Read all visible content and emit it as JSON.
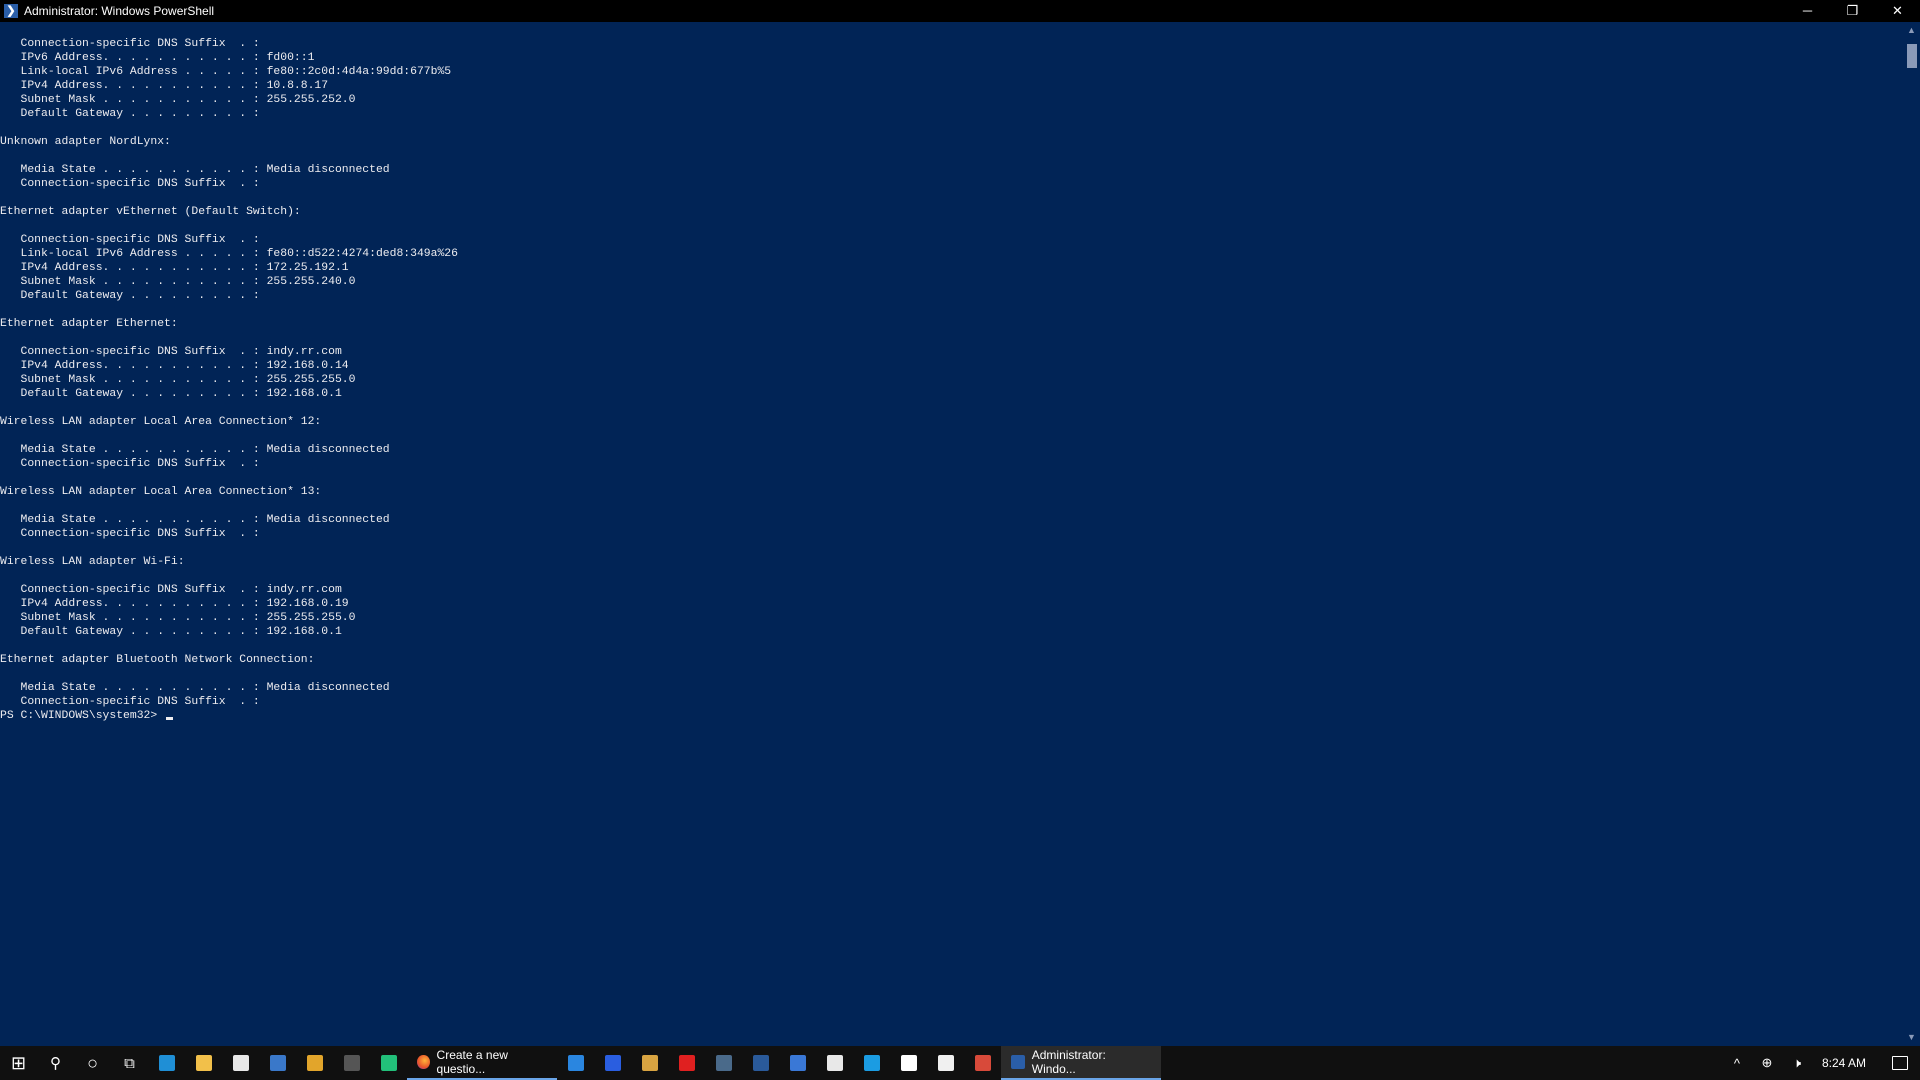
{
  "window": {
    "title": "Administrator: Windows PowerShell",
    "icon_glyph": "❯",
    "controls": {
      "minimize": "─",
      "restore": "❐",
      "close": "✕"
    }
  },
  "console": {
    "lines": [
      "   Connection-specific DNS Suffix  . :",
      "   IPv6 Address. . . . . . . . . . . : fd00::1",
      "   Link-local IPv6 Address . . . . . : fe80::2c0d:4d4a:99dd:677b%5",
      "   IPv4 Address. . . . . . . . . . . : 10.8.8.17",
      "   Subnet Mask . . . . . . . . . . . : 255.255.252.0",
      "   Default Gateway . . . . . . . . . :",
      "",
      "Unknown adapter NordLynx:",
      "",
      "   Media State . . . . . . . . . . . : Media disconnected",
      "   Connection-specific DNS Suffix  . :",
      "",
      "Ethernet adapter vEthernet (Default Switch):",
      "",
      "   Connection-specific DNS Suffix  . :",
      "   Link-local IPv6 Address . . . . . : fe80::d522:4274:ded8:349a%26",
      "   IPv4 Address. . . . . . . . . . . : 172.25.192.1",
      "   Subnet Mask . . . . . . . . . . . : 255.255.240.0",
      "   Default Gateway . . . . . . . . . :",
      "",
      "Ethernet adapter Ethernet:",
      "",
      "   Connection-specific DNS Suffix  . : indy.rr.com",
      "   IPv4 Address. . . . . . . . . . . : 192.168.0.14",
      "   Subnet Mask . . . . . . . . . . . : 255.255.255.0",
      "   Default Gateway . . . . . . . . . : 192.168.0.1",
      "",
      "Wireless LAN adapter Local Area Connection* 12:",
      "",
      "   Media State . . . . . . . . . . . : Media disconnected",
      "   Connection-specific DNS Suffix  . :",
      "",
      "Wireless LAN adapter Local Area Connection* 13:",
      "",
      "   Media State . . . . . . . . . . . : Media disconnected",
      "   Connection-specific DNS Suffix  . :",
      "",
      "Wireless LAN adapter Wi-Fi:",
      "",
      "   Connection-specific DNS Suffix  . : indy.rr.com",
      "   IPv4 Address. . . . . . . . . . . : 192.168.0.19",
      "   Subnet Mask . . . . . . . . . . . : 255.255.255.0",
      "   Default Gateway . . . . . . . . . : 192.168.0.1",
      "",
      "Ethernet adapter Bluetooth Network Connection:",
      "",
      "   Media State . . . . . . . . . . . : Media disconnected",
      "   Connection-specific DNS Suffix  . :"
    ],
    "prompt": "PS C:\\WINDOWS\\system32> ",
    "colors": {
      "background": "#012456",
      "foreground": "#eeedf0"
    }
  },
  "scrollbar": {
    "up_glyph": "▲",
    "down_glyph": "▼"
  },
  "taskbar": {
    "start_glyph": "⊞",
    "search_glyph": "⚲",
    "cortana_glyph": "○",
    "taskview_glyph": "⧉",
    "pinned": [
      {
        "name": "edge-icon",
        "color": "#1f8fd6"
      },
      {
        "name": "file-explorer-icon",
        "color": "#f2c04a"
      },
      {
        "name": "mail-icon",
        "color": "#e8e8e8"
      },
      {
        "name": "store-icon",
        "color": "#3a78c9"
      },
      {
        "name": "chrome-icon",
        "color": "#e2a52b"
      },
      {
        "name": "app-icon",
        "color": "#555555"
      },
      {
        "name": "green-app-icon",
        "color": "#22c07a"
      }
    ],
    "firefox_label": "Create a new questio...",
    "pinned2": [
      {
        "name": "blue-app-icon",
        "color": "#2a86e0"
      },
      {
        "name": "malwarebytes-icon",
        "color": "#2a5ee0"
      },
      {
        "name": "calculator-icon",
        "color": "#d9a441"
      },
      {
        "name": "opera-icon",
        "color": "#e02020"
      },
      {
        "name": "vpn-icon",
        "color": "#4a6a8a"
      },
      {
        "name": "nordvpn-icon",
        "color": "#2a5a9a"
      },
      {
        "name": "text-app-icon",
        "color": "#3a78d6"
      },
      {
        "name": "camera-icon",
        "color": "#e8e8e8"
      },
      {
        "name": "skype-icon",
        "color": "#1b9ce2"
      },
      {
        "name": "image-icon",
        "color": "#ffffff"
      },
      {
        "name": "notepad-icon",
        "color": "#f0f0f0"
      },
      {
        "name": "red-app-icon",
        "color": "#d84a3a"
      }
    ],
    "powershell_label": "Administrator: Windo...",
    "tray": {
      "chevron_glyph": "^",
      "network_glyph": "⊕",
      "volume_glyph": "🕨",
      "time": "8:24 AM"
    }
  }
}
